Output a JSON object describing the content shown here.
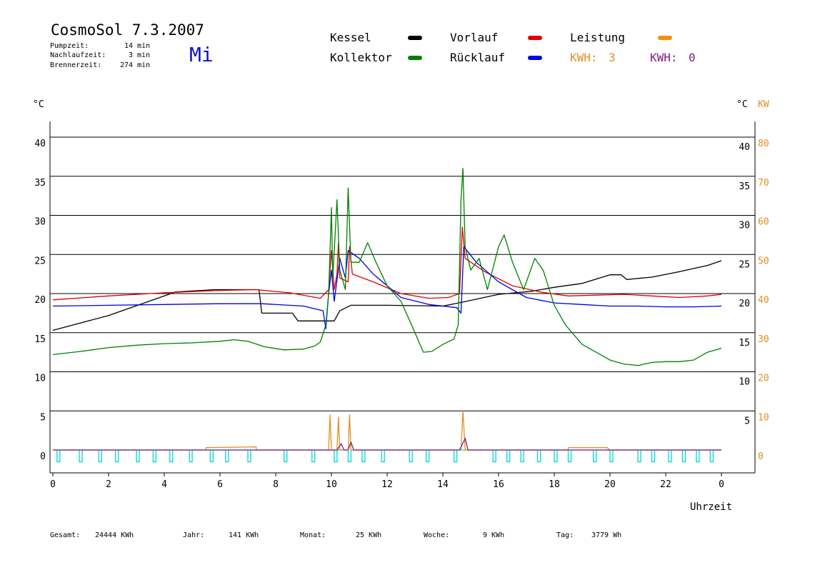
{
  "header": {
    "title": "CosmoSol 7.3.2007",
    "weekday": "Mi",
    "stats": [
      {
        "label": "Pumpzeit:",
        "value": "14 min"
      },
      {
        "label": "Nachlaufzeit:",
        "value": "3 min"
      },
      {
        "label": "Brennerzeit:",
        "value": "274 min"
      }
    ]
  },
  "legend": {
    "items": [
      {
        "label": "Kessel",
        "color": "#000000"
      },
      {
        "label": "Vorlauf",
        "color": "#e00000"
      },
      {
        "label": "Leistung",
        "color": "#ff8c00"
      },
      {
        "label": "Kollektor",
        "color": "#008000"
      },
      {
        "label": "Rücklauf",
        "color": "#0000e0"
      }
    ],
    "kwh1": {
      "label": "KWH:",
      "value": "3",
      "color": "#e09020"
    },
    "kwh2": {
      "label": "KWH:",
      "value": "0",
      "color": "#802080"
    }
  },
  "footer": [
    {
      "label": "Gesamt:",
      "value": "24444 KWh"
    },
    {
      "label": "Jahr:",
      "value": "141 KWh"
    },
    {
      "label": "Monat:",
      "value": "25 KWh"
    },
    {
      "label": "Woche:",
      "value": "9 KWh"
    },
    {
      "label": "Tag:",
      "value": "3779 Wh"
    }
  ],
  "chart_data": {
    "type": "line",
    "xlabel": "Uhrzeit",
    "left_unit": "°C",
    "right_unit": "°C",
    "right_unit2": "KW",
    "xlim": [
      0,
      24
    ],
    "ylim": [
      0,
      40
    ],
    "x_ticks": [
      0,
      2,
      4,
      6,
      8,
      10,
      12,
      14,
      16,
      18,
      20,
      22,
      24
    ],
    "x_tick_labels": [
      "0",
      "2",
      "4",
      "6",
      "8",
      "10",
      "12",
      "14",
      "16",
      "18",
      "20",
      "22",
      "0"
    ],
    "y_ticks": [
      0,
      5,
      10,
      15,
      20,
      25,
      30,
      35,
      40
    ],
    "y_tick_labels": [
      "0",
      "5",
      "10",
      "15",
      "20",
      "25",
      "30",
      "35",
      "40"
    ],
    "y2_tick_labels": [
      "0",
      "10",
      "20",
      "30",
      "40",
      "50",
      "60",
      "70",
      "80"
    ],
    "grid": true,
    "series": [
      {
        "name": "Kessel",
        "color": "#000000",
        "points": [
          [
            0,
            15.3
          ],
          [
            2,
            17.2
          ],
          [
            4.4,
            20.2
          ],
          [
            5.8,
            20.5
          ],
          [
            7.4,
            20.5
          ],
          [
            7.5,
            17.5
          ],
          [
            8.6,
            17.5
          ],
          [
            8.8,
            16.5
          ],
          [
            10.1,
            16.5
          ],
          [
            10.3,
            17.8
          ],
          [
            10.7,
            18.5
          ],
          [
            12,
            18.5
          ],
          [
            14,
            18.4
          ],
          [
            14.7,
            18.9
          ],
          [
            16,
            19.9
          ],
          [
            17.2,
            20.3
          ],
          [
            18,
            20.8
          ],
          [
            19,
            21.3
          ],
          [
            20,
            22.4
          ],
          [
            20.4,
            22.4
          ],
          [
            20.6,
            21.8
          ],
          [
            21.5,
            22.1
          ],
          [
            22.5,
            22.8
          ],
          [
            23.5,
            23.6
          ],
          [
            24,
            24.2
          ]
        ]
      },
      {
        "name": "Vorlauf",
        "color": "#e00000",
        "points": [
          [
            0,
            19.2
          ],
          [
            2,
            19.7
          ],
          [
            4,
            20.1
          ],
          [
            6,
            20.4
          ],
          [
            7.3,
            20.5
          ],
          [
            8.5,
            20.1
          ],
          [
            9.6,
            19.4
          ],
          [
            9.9,
            20.5
          ],
          [
            10.0,
            25.5
          ],
          [
            10.1,
            20.5
          ],
          [
            10.2,
            22.5
          ],
          [
            10.25,
            26.5
          ],
          [
            10.3,
            22
          ],
          [
            10.6,
            21.5
          ],
          [
            10.65,
            26
          ],
          [
            10.75,
            22.5
          ],
          [
            11.5,
            21.5
          ],
          [
            12.5,
            20
          ],
          [
            13.5,
            19.4
          ],
          [
            14.2,
            19.5
          ],
          [
            14.6,
            20
          ],
          [
            14.7,
            28.5
          ],
          [
            14.8,
            24.5
          ],
          [
            15.5,
            22.8
          ],
          [
            16.5,
            21
          ],
          [
            17.5,
            20.2
          ],
          [
            18.5,
            19.7
          ],
          [
            19.5,
            19.8
          ],
          [
            20.5,
            19.9
          ],
          [
            21.5,
            19.7
          ],
          [
            22.5,
            19.5
          ],
          [
            23.5,
            19.7
          ],
          [
            24,
            19.9
          ]
        ]
      },
      {
        "name": "Rücklauf",
        "color": "#0000e0",
        "points": [
          [
            0,
            18.4
          ],
          [
            2,
            18.5
          ],
          [
            4,
            18.6
          ],
          [
            6,
            18.7
          ],
          [
            7.5,
            18.7
          ],
          [
            9,
            18.4
          ],
          [
            9.7,
            17.8
          ],
          [
            9.8,
            15.5
          ],
          [
            9.9,
            20
          ],
          [
            10.0,
            23
          ],
          [
            10.1,
            19
          ],
          [
            10.3,
            24.5
          ],
          [
            10.5,
            22
          ],
          [
            10.6,
            25.5
          ],
          [
            11,
            24.5
          ],
          [
            11.5,
            22.5
          ],
          [
            12.5,
            19.5
          ],
          [
            13.5,
            18.6
          ],
          [
            14.5,
            18.2
          ],
          [
            14.65,
            17.5
          ],
          [
            14.75,
            26
          ],
          [
            15.2,
            24
          ],
          [
            16,
            21.5
          ],
          [
            17,
            19.5
          ],
          [
            18,
            18.8
          ],
          [
            19,
            18.6
          ],
          [
            20,
            18.4
          ],
          [
            21,
            18.4
          ],
          [
            22,
            18.3
          ],
          [
            23,
            18.3
          ],
          [
            24,
            18.4
          ]
        ]
      },
      {
        "name": "Kollektor",
        "color": "#008000",
        "points": [
          [
            0,
            12.2
          ],
          [
            1,
            12.6
          ],
          [
            2,
            13.1
          ],
          [
            3,
            13.4
          ],
          [
            4,
            13.6
          ],
          [
            5,
            13.7
          ],
          [
            6,
            13.9
          ],
          [
            6.5,
            14.1
          ],
          [
            7,
            13.9
          ],
          [
            7.6,
            13.2
          ],
          [
            8.3,
            12.8
          ],
          [
            9,
            12.9
          ],
          [
            9.4,
            13.3
          ],
          [
            9.6,
            13.8
          ],
          [
            9.8,
            16
          ],
          [
            9.9,
            20
          ],
          [
            10.0,
            31
          ],
          [
            10.05,
            22
          ],
          [
            10.2,
            32
          ],
          [
            10.3,
            23
          ],
          [
            10.5,
            20.5
          ],
          [
            10.6,
            33.5
          ],
          [
            10.7,
            24
          ],
          [
            11,
            24
          ],
          [
            11.3,
            26.5
          ],
          [
            11.6,
            24
          ],
          [
            12,
            21
          ],
          [
            12.5,
            19
          ],
          [
            13,
            15
          ],
          [
            13.3,
            12.5
          ],
          [
            13.6,
            12.6
          ],
          [
            14,
            13.5
          ],
          [
            14.4,
            14.2
          ],
          [
            14.55,
            16
          ],
          [
            14.65,
            32
          ],
          [
            14.72,
            36
          ],
          [
            14.8,
            26
          ],
          [
            15,
            23
          ],
          [
            15.3,
            24.5
          ],
          [
            15.6,
            20.5
          ],
          [
            16,
            26
          ],
          [
            16.2,
            27.5
          ],
          [
            16.5,
            24
          ],
          [
            16.9,
            20.5
          ],
          [
            17.3,
            24.5
          ],
          [
            17.6,
            23
          ],
          [
            18,
            18.5
          ],
          [
            18.4,
            16
          ],
          [
            19,
            13.5
          ],
          [
            19.5,
            12.5
          ],
          [
            20,
            11.5
          ],
          [
            20.5,
            11
          ],
          [
            21,
            10.8
          ],
          [
            21.5,
            11.2
          ],
          [
            22,
            11.3
          ],
          [
            22.5,
            11.3
          ],
          [
            23,
            11.5
          ],
          [
            23.5,
            12.5
          ],
          [
            24,
            13
          ]
        ]
      },
      {
        "name": "Leistung",
        "color": "#e09020",
        "points": [
          [
            0,
            0
          ],
          [
            5.5,
            0
          ],
          [
            5.5,
            0.3
          ],
          [
            7.3,
            0.4
          ],
          [
            7.3,
            0
          ],
          [
            9.9,
            0
          ],
          [
            9.95,
            4.5
          ],
          [
            10.0,
            0
          ],
          [
            10.2,
            0
          ],
          [
            10.25,
            4.2
          ],
          [
            10.3,
            0
          ],
          [
            10.6,
            0
          ],
          [
            10.65,
            4.5
          ],
          [
            10.7,
            0
          ],
          [
            14.65,
            0
          ],
          [
            14.72,
            5
          ],
          [
            14.8,
            0
          ],
          [
            18.5,
            0
          ],
          [
            18.5,
            0.3
          ],
          [
            19.9,
            0.3
          ],
          [
            20,
            0
          ],
          [
            24,
            0
          ]
        ]
      },
      {
        "name": "KWH2",
        "color": "#802080",
        "points": [
          [
            0,
            0
          ],
          [
            10.2,
            0
          ],
          [
            10.35,
            0.8
          ],
          [
            10.45,
            0
          ],
          [
            10.6,
            0
          ],
          [
            10.7,
            1
          ],
          [
            10.8,
            0
          ],
          [
            14.6,
            0
          ],
          [
            14.8,
            1.5
          ],
          [
            14.9,
            0
          ],
          [
            24,
            0
          ]
        ]
      }
    ],
    "pump_pulses": {
      "color": "#00d8d8",
      "x": [
        0.15,
        0.95,
        1.65,
        2.25,
        3,
        3.6,
        4.2,
        4.9,
        5.65,
        6.2,
        7,
        8.3,
        9.3,
        10.1,
        10.6,
        11.1,
        11.8,
        12.8,
        13.4,
        14.4,
        15.8,
        16.3,
        16.8,
        17.4,
        18,
        18.5,
        19.4,
        20,
        21,
        21.5,
        22.1,
        22.6,
        23.1,
        23.6
      ],
      "depth": -1.5
    }
  }
}
